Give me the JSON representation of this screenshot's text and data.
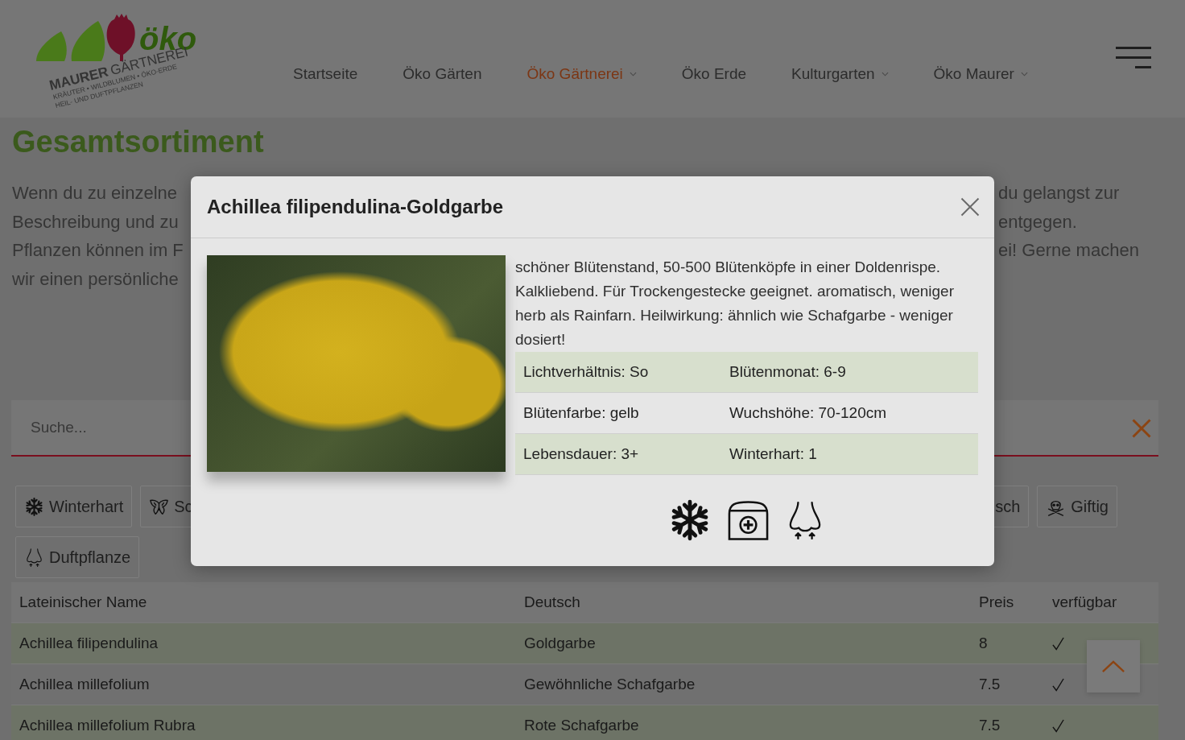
{
  "header": {
    "logo": {
      "wordmark": "öko",
      "name": "MAURER",
      "trade": "GÄRTNEREI",
      "tagline_1": "KRÄUTER • WILDBLUMEN • ÖKO-ERDE",
      "tagline_2": "HEIL- UND DUFTPFLANZEN"
    },
    "nav": [
      {
        "label": "Startseite",
        "selected": false,
        "submenu": false
      },
      {
        "label": "Öko Gärten",
        "selected": false,
        "submenu": false
      },
      {
        "label": "Öko Gärtnerei",
        "selected": true,
        "submenu": true
      },
      {
        "label": "Öko Erde",
        "selected": false,
        "submenu": false
      },
      {
        "label": "Kulturgarten",
        "selected": false,
        "submenu": true
      },
      {
        "label": "Öko Maurer",
        "selected": false,
        "submenu": true
      }
    ]
  },
  "page": {
    "title": "Gesamtsortiment",
    "intro": [
      {
        "left": "Wenn du zu einzelne",
        "right": "du gelangst zur"
      },
      {
        "left": "Beschreibung und zu",
        "right": "entgegen."
      },
      {
        "left": "Pflanzen können im F",
        "right": "ei! Gerne machen"
      },
      {
        "left": "wir einen persönliche"
      }
    ]
  },
  "search": {
    "placeholder": "Suche..."
  },
  "filters": {
    "first_line": {
      "left": [
        {
          "label": "Winterhart",
          "kind": "frost"
        },
        {
          "label": "Sc",
          "kind": "butterfly"
        }
      ],
      "right": [
        {
          "label": "sch",
          "kind": "hidden"
        },
        {
          "label": "Giftig",
          "kind": "poison"
        }
      ]
    },
    "second_line": [
      {
        "label": "Duftpflanze",
        "kind": "scent"
      }
    ]
  },
  "table": {
    "columns": [
      "Lateinischer Name",
      "Deutsch",
      "Preis",
      "verfügbar"
    ],
    "rows": [
      {
        "latin": "Achillea filipendulina",
        "german": "Goldgarbe",
        "price": "8",
        "available": true
      },
      {
        "latin": "Achillea millefolium",
        "german": "Gewöhnliche Schafgarbe",
        "price": "7.5",
        "available": true
      },
      {
        "latin": "Achillea millefolium Rubra",
        "german": "Rote Schafgarbe",
        "price": "7.5",
        "available": true
      }
    ]
  },
  "modal": {
    "title": "Achillea filipendulina-Goldgarbe",
    "description": "schöner Blütenstand, 50-500 Blütenköpfe in einer Doldenrispe. Kalkliebend. Für Trockengestecke geeignet. aromatisch, weniger herb als Rainfarn. Heilwirkung: ähnlich wie Schafgarbe - weniger dosiert!",
    "attributes": [
      [
        "Lichtverhältnis: So",
        "Blütenmonat: 6-9"
      ],
      [
        "Blütenfarbe: gelb",
        "Wuchshöhe: 70-120cm"
      ],
      [
        "Lebensdauer: 3+",
        "Winterhart: 1"
      ]
    ],
    "icons": [
      {
        "kind": "frost"
      },
      {
        "kind": "medicinal"
      },
      {
        "kind": "scent"
      }
    ]
  }
}
